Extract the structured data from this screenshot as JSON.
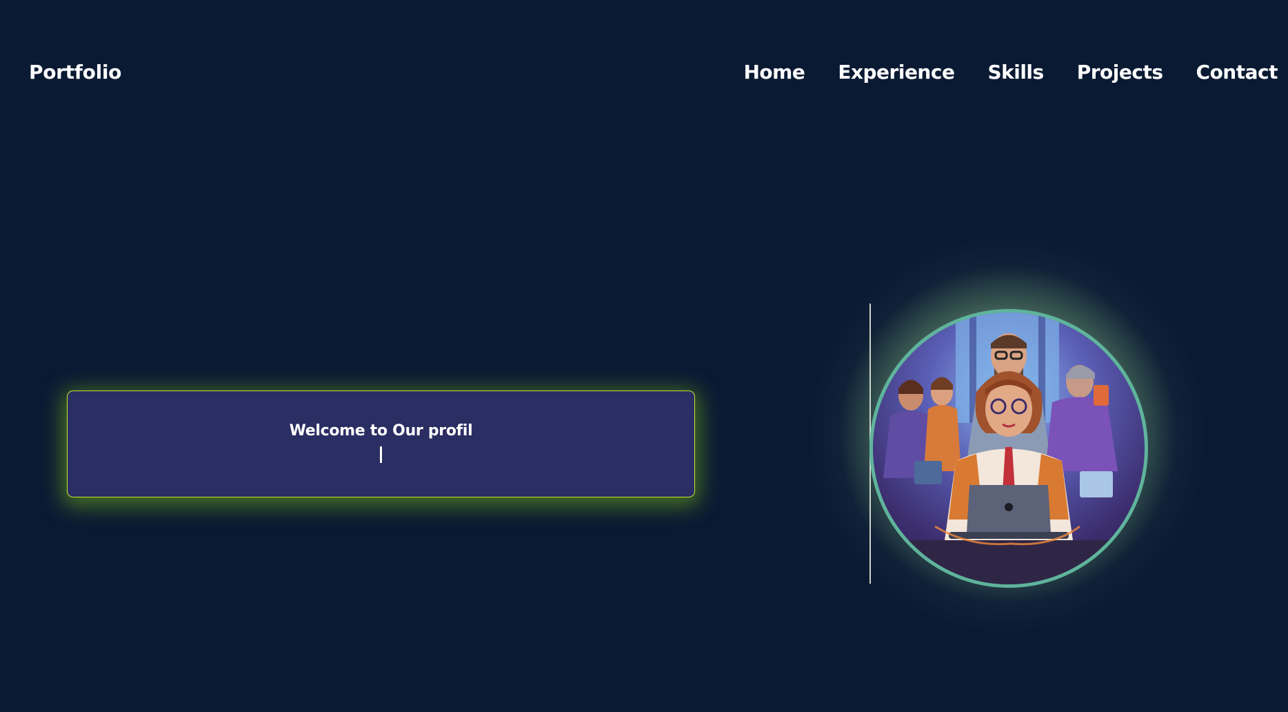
{
  "header": {
    "brand": "Portfolio",
    "nav": [
      {
        "label": "Home"
      },
      {
        "label": "Experience"
      },
      {
        "label": "Skills"
      },
      {
        "label": "Projects"
      },
      {
        "label": "Contact"
      }
    ]
  },
  "hero": {
    "welcome_text": "Welcome to Our profil"
  },
  "colors": {
    "background": "#0b1a33",
    "card": "#2b2e63",
    "card_border": "#c7e332",
    "avatar_ring": "#5fb49c"
  }
}
